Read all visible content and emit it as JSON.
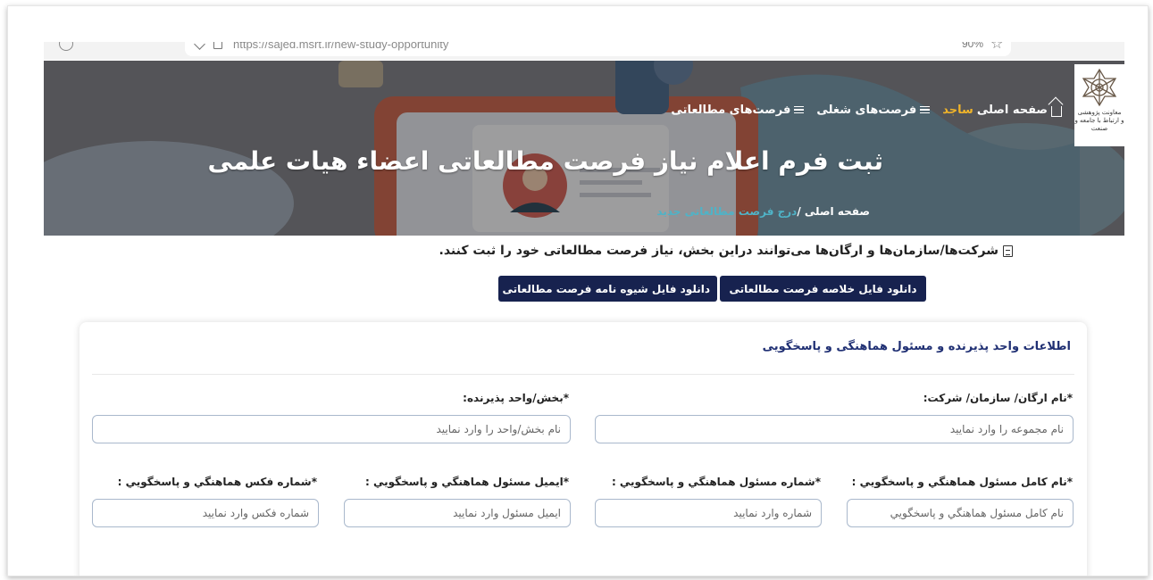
{
  "browser": {
    "url": "https://sajed.msrt.ir/new-study-opportunity",
    "zoom": "90%"
  },
  "logo": {
    "caption": "معاونت پژوهشی\nو ارتباط با جامعه و صنعت"
  },
  "nav": {
    "home_label": "صفحه اصلی",
    "brand": "ساجد",
    "jobs_label": "فرصت‌های شغلی",
    "study_label": "فرصت‌های مطالعاتی"
  },
  "hero": {
    "title": "ثبت فرم اعلام نیاز فرصت مطالعاتی اعضاء هیات علمی"
  },
  "breadcrumb": {
    "home": "صفحه اصلی",
    "separator": " /",
    "current": "درج فرصت مطالعاتی جدید"
  },
  "intro": {
    "text": "شرکت‌ها/سازمان‌ها و ارگان‌ها می‌توانند دراین بخش، نیاز فرصت مطالعاتی خود را ثبت کنند."
  },
  "downloads": {
    "summary_label": "دانلود فایل خلاصه فرصت مطالعاتی",
    "guide_label": "دانلود فایل شیوه نامه فرصت مطالعاتی"
  },
  "form": {
    "section_title": "اطلاعات واحد پذیرنده و مسئول هماهنگی و پاسخگویی",
    "org_label": "*نام ارگان/ سازمان/ شرکت:",
    "org_placeholder": "نام مجموعه را وارد نمایید",
    "unit_label": "*بخش/واحد پذیرنده:",
    "unit_placeholder": "نام بخش/واحد را وارد نمایید",
    "contact_name_label": "*نام کامل مسئول هماهنگي و پاسخگويي :",
    "contact_name_placeholder": "نام کامل مسئول هماهنگي و پاسخگويي",
    "phone_label": "*شماره مسئول هماهنگي و پاسخگويي :",
    "phone_placeholder": "شماره وارد نمایید",
    "email_label": "*ایمیل مسئول هماهنگي و پاسخگويي :",
    "email_placeholder": "ایمیل مسئول وارد نمایید",
    "fax_label": "*شماره فکس هماهنگي و پاسخگويي :",
    "fax_placeholder": "شماره فکس وارد نمایید"
  },
  "colors": {
    "navy_button": "#17224f",
    "section_title": "#1f2f73",
    "brand_accent": "#f0b42a",
    "breadcrumb_current": "#4fb3c7"
  }
}
